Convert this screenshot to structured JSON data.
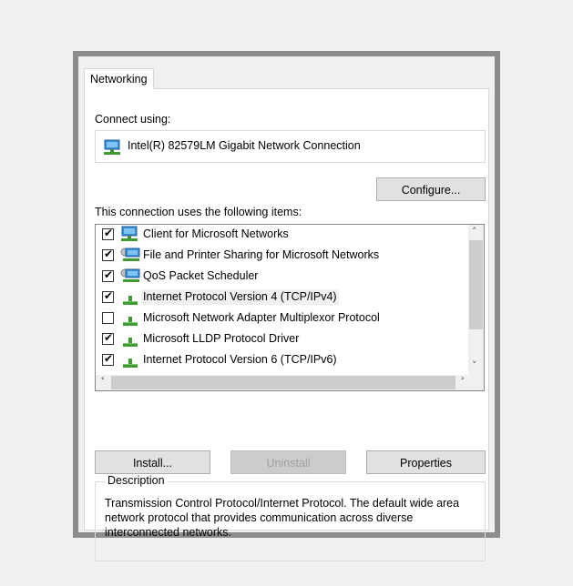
{
  "tab": {
    "label": "Networking"
  },
  "connect": {
    "label": "Connect using:",
    "adapter": "Intel(R) 82579LM Gigabit Network Connection"
  },
  "buttons": {
    "configure": "Configure...",
    "install": "Install...",
    "uninstall": "Uninstall",
    "properties": "Properties"
  },
  "items": {
    "label": "This connection uses the following items:",
    "list": [
      {
        "label": "Client for Microsoft Networks",
        "checked": true,
        "icon": "network-client-icon"
      },
      {
        "label": "File and Printer Sharing for Microsoft Networks",
        "checked": true,
        "icon": "network-service-icon"
      },
      {
        "label": "QoS Packet Scheduler",
        "checked": true,
        "icon": "network-service-icon"
      },
      {
        "label": "Internet Protocol Version 4 (TCP/IPv4)",
        "checked": true,
        "icon": "network-protocol-icon",
        "selected": true
      },
      {
        "label": "Microsoft Network Adapter Multiplexor Protocol",
        "checked": false,
        "icon": "network-protocol-icon"
      },
      {
        "label": "Microsoft LLDP Protocol Driver",
        "checked": true,
        "icon": "network-protocol-icon"
      },
      {
        "label": "Internet Protocol Version 6 (TCP/IPv6)",
        "checked": true,
        "icon": "network-protocol-icon"
      }
    ]
  },
  "description": {
    "legend": "Description",
    "text": "Transmission Control Protocol/Internet Protocol. The default wide area network protocol that provides communication across diverse interconnected networks."
  },
  "colors": {
    "frame": "#8c8c8c",
    "background": "#f0f0f0",
    "panel": "#ffffff"
  }
}
